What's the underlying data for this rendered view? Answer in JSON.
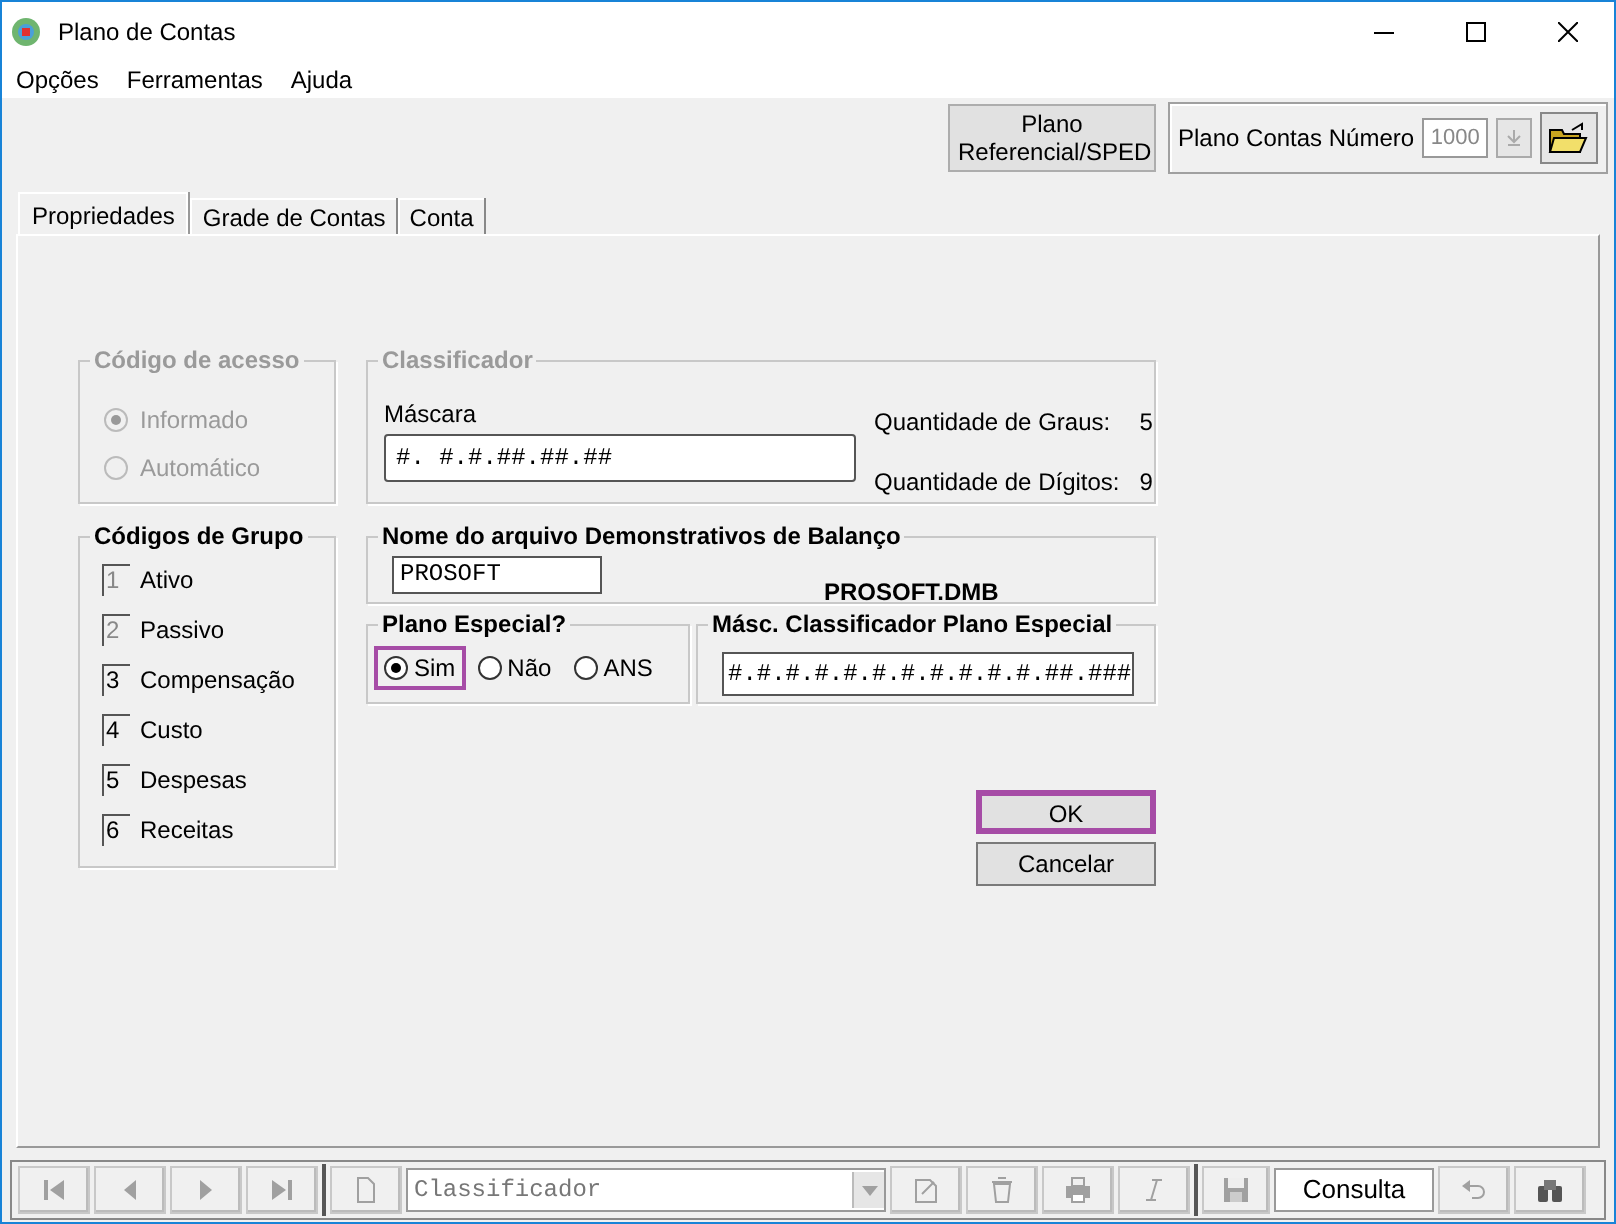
{
  "window": {
    "title": "Plano de Contas"
  },
  "menu": [
    "Opções",
    "Ferramentas",
    "Ajuda"
  ],
  "toolbar": {
    "referencial_button": "Plano Referencial/SPED",
    "numero_label": "Plano Contas Número",
    "numero_value": "1000"
  },
  "tabs": [
    {
      "label": "Propriedades",
      "selected": true
    },
    {
      "label": "Grade de Contas",
      "selected": false
    },
    {
      "label": "Conta",
      "selected": false
    }
  ],
  "codigo_acesso": {
    "title": "Código de acesso",
    "disabled": true,
    "options": [
      {
        "label": "Informado",
        "selected": true
      },
      {
        "label": "Automático",
        "selected": false
      }
    ]
  },
  "classificador": {
    "title": "Classificador",
    "disabled": true,
    "mascara_label": "Máscara",
    "mascara_value": "#. #.#.##.##.##",
    "graus_label": "Quantidade de Graus:",
    "graus_value": "5",
    "digitos_label": "Quantidade de Dígitos:",
    "digitos_value": "9"
  },
  "codigos_grupo": {
    "title": "Códigos de Grupo",
    "items": [
      {
        "code": "1",
        "label": "Ativo"
      },
      {
        "code": "2",
        "label": "Passivo"
      },
      {
        "code": "3",
        "label": "Compensação"
      },
      {
        "code": "4",
        "label": "Custo"
      },
      {
        "code": "5",
        "label": "Despesas"
      },
      {
        "code": "6",
        "label": "Receitas"
      }
    ]
  },
  "nome_arquivo": {
    "title": "Nome do arquivo Demonstrativos de Balanço",
    "value": "PROSOFT",
    "filename": "PROSOFT.DMB"
  },
  "plano_especial": {
    "title": "Plano Especial?",
    "options": [
      {
        "label": "Sim",
        "selected": true,
        "highlighted": true
      },
      {
        "label": "Não",
        "selected": false,
        "highlighted": false
      },
      {
        "label": "ANS",
        "selected": false,
        "highlighted": false
      }
    ]
  },
  "masc_especial": {
    "title": "Másc. Classificador Plano Especial",
    "value": "#.#.#.#.#.#.#.#.#.#.#.##.###"
  },
  "buttons": [
    {
      "label": "OK",
      "highlighted": true
    },
    {
      "label": "Cancelar",
      "highlighted": false
    }
  ],
  "status_bar": {
    "field_value": "Classificador",
    "mode": "Consulta"
  }
}
